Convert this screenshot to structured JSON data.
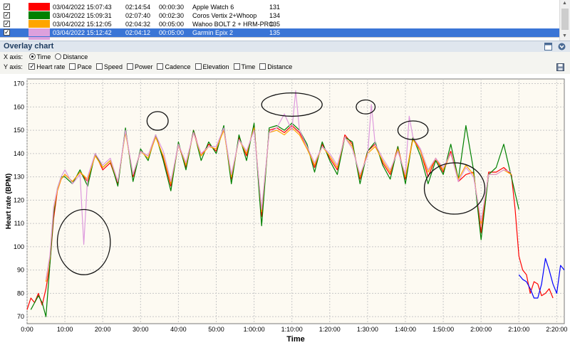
{
  "table": {
    "rows": [
      {
        "checked": true,
        "color": "#ff0000",
        "date": "03/04/2022 15:07:43",
        "duration": "02:14:54",
        "offset": "00:00:30",
        "name": "Apple Watch 6",
        "value": "131",
        "selected": false
      },
      {
        "checked": true,
        "color": "#008000",
        "date": "03/04/2022 15:09:31",
        "duration": "02:07:40",
        "offset": "00:02:30",
        "name": "Coros Vertix 2+Whoop",
        "value": "134",
        "selected": false
      },
      {
        "checked": true,
        "color": "#ffa500",
        "date": "03/04/2022 15:12:05",
        "duration": "02:04:32",
        "offset": "00:05:00",
        "name": "Wahoo BOLT 2 + HRM-PRO",
        "value": "135",
        "selected": false
      },
      {
        "checked": true,
        "color": "#dda0dd",
        "date": "03/04/2022 15:12:42",
        "duration": "02:04:12",
        "offset": "00:05:00",
        "name": "Garmin Epix 2",
        "value": "135",
        "selected": true
      }
    ]
  },
  "panel": {
    "title": "Overlay chart"
  },
  "controls": {
    "xaxis_label": "X axis:",
    "xaxis_options": [
      {
        "label": "Time",
        "selected": true
      },
      {
        "label": "Distance",
        "selected": false
      }
    ],
    "yaxis_label": "Y axis:",
    "yaxis_options": [
      {
        "label": "Heart rate",
        "checked": true
      },
      {
        "label": "Pace",
        "checked": false
      },
      {
        "label": "Speed",
        "checked": false
      },
      {
        "label": "Power",
        "checked": false
      },
      {
        "label": "Cadence",
        "checked": false
      },
      {
        "label": "Elevation",
        "checked": false
      },
      {
        "label": "Time",
        "checked": false
      },
      {
        "label": "Distance",
        "checked": false
      }
    ]
  },
  "chart_data": {
    "type": "line",
    "xlabel": "Time",
    "ylabel": "Heart rate (BPM)",
    "xlim": [
      0,
      142
    ],
    "ylim": [
      67,
      172
    ],
    "yticks": [
      70,
      80,
      90,
      100,
      110,
      120,
      130,
      140,
      150,
      160,
      170
    ],
    "xticks": [
      {
        "v": 0,
        "label": "0:00"
      },
      {
        "v": 10,
        "label": "10:00"
      },
      {
        "v": 20,
        "label": "20:00"
      },
      {
        "v": 30,
        "label": "30:00"
      },
      {
        "v": 40,
        "label": "40:00"
      },
      {
        "v": 50,
        "label": "50:00"
      },
      {
        "v": 60,
        "label": "1:00:00"
      },
      {
        "v": 70,
        "label": "1:10:00"
      },
      {
        "v": 80,
        "label": "1:20:00"
      },
      {
        "v": 90,
        "label": "1:30:00"
      },
      {
        "v": 100,
        "label": "1:40:00"
      },
      {
        "v": 110,
        "label": "1:50:00"
      },
      {
        "v": 120,
        "label": "2:00:00"
      },
      {
        "v": 130,
        "label": "2:10:00"
      },
      {
        "v": 140,
        "label": "2:20:00"
      }
    ],
    "grid": true,
    "background": "#fdfaf2",
    "series": [
      {
        "color": "#ff0000",
        "x": [
          0,
          1,
          2,
          3,
          4,
          5,
          6,
          7,
          8,
          9,
          10,
          12,
          14,
          16,
          18,
          20,
          22,
          24,
          26,
          28,
          30,
          32,
          34,
          36,
          38,
          40,
          42,
          44,
          46,
          48,
          50,
          52,
          54,
          56,
          58,
          60,
          62,
          64,
          66,
          68,
          70,
          72,
          74,
          76,
          78,
          80,
          82,
          84,
          86,
          88,
          90,
          92,
          94,
          96,
          98,
          100,
          102,
          104,
          106,
          108,
          110,
          112,
          114,
          116,
          118,
          120,
          122,
          124,
          126,
          128,
          129,
          130,
          131,
          132,
          133,
          134,
          135,
          136,
          137,
          138,
          139
        ],
        "y": [
          73,
          78,
          76,
          80,
          75,
          82,
          92,
          112,
          124,
          129,
          131,
          128,
          132,
          128,
          140,
          133,
          136,
          127,
          150,
          130,
          141,
          139,
          148,
          138,
          126,
          144,
          134,
          150,
          139,
          144,
          141,
          151,
          129,
          147,
          139,
          152,
          113,
          150,
          151,
          149,
          152,
          149,
          143,
          134,
          144,
          138,
          133,
          148,
          144,
          129,
          141,
          144,
          136,
          131,
          143,
          129,
          147,
          141,
          130,
          138,
          132,
          141,
          128,
          131,
          132,
          106,
          132,
          132,
          134,
          131,
          116,
          96,
          90,
          88,
          80,
          85,
          84,
          79,
          80,
          82,
          78
        ]
      },
      {
        "color": "#008000",
        "x": [
          1,
          2,
          3,
          4,
          5,
          6,
          7,
          8,
          9,
          10,
          12,
          14,
          16,
          18,
          20,
          22,
          24,
          26,
          28,
          30,
          32,
          34,
          36,
          38,
          40,
          42,
          44,
          46,
          48,
          50,
          52,
          54,
          56,
          58,
          60,
          62,
          64,
          66,
          68,
          70,
          72,
          74,
          76,
          78,
          80,
          82,
          84,
          86,
          88,
          90,
          92,
          94,
          96,
          98,
          100,
          102,
          104,
          106,
          108,
          110,
          112,
          114,
          116,
          118,
          120,
          122,
          124,
          126,
          128,
          130
        ],
        "y": [
          73,
          76,
          79,
          76,
          70,
          92,
          114,
          125,
          130,
          130,
          127,
          133,
          126,
          140,
          134,
          137,
          126,
          151,
          128,
          142,
          137,
          148,
          137,
          124,
          145,
          133,
          150,
          137,
          145,
          140,
          152,
          127,
          148,
          137,
          153,
          109,
          151,
          152,
          150,
          153,
          150,
          144,
          132,
          145,
          137,
          131,
          147,
          145,
          127,
          141,
          145,
          135,
          129,
          143,
          127,
          147,
          139,
          127,
          137,
          131,
          144,
          129,
          152,
          133,
          103,
          131,
          134,
          144,
          130,
          116
        ]
      },
      {
        "color": "#ffa500",
        "x": [
          5,
          6,
          7,
          8,
          9,
          10,
          12,
          14,
          16,
          18,
          20,
          22,
          24,
          26,
          28,
          30,
          32,
          34,
          36,
          38,
          40,
          42,
          44,
          46,
          48,
          50,
          52,
          54,
          56,
          58,
          60,
          62,
          64,
          66,
          68,
          70,
          72,
          74,
          76,
          78,
          80,
          82,
          84,
          86,
          88,
          90,
          92,
          94,
          96,
          98,
          100,
          102,
          104,
          106,
          108,
          110,
          112,
          114,
          116,
          118,
          120,
          122,
          124,
          126,
          128
        ],
        "y": [
          85,
          95,
          116,
          124,
          129,
          131,
          128,
          132,
          129,
          139,
          134,
          137,
          128,
          149,
          131,
          141,
          138,
          147,
          139,
          127,
          144,
          135,
          149,
          139,
          143,
          142,
          150,
          130,
          146,
          140,
          151,
          115,
          149,
          150,
          148,
          151,
          148,
          142,
          135,
          143,
          139,
          134,
          147,
          143,
          130,
          140,
          143,
          137,
          132,
          142,
          130,
          146,
          141,
          132,
          138,
          133,
          140,
          129,
          135,
          131,
          110,
          131,
          131,
          133,
          131
        ]
      },
      {
        "color": "#dd99dd",
        "x": [
          5,
          6,
          7,
          8,
          9,
          10,
          12,
          14,
          15,
          16,
          18,
          20,
          22,
          24,
          26,
          28,
          30,
          32,
          34,
          36,
          38,
          40,
          42,
          44,
          46,
          48,
          50,
          52,
          54,
          56,
          58,
          60,
          62,
          64,
          66,
          68,
          70,
          71,
          72,
          74,
          76,
          78,
          80,
          82,
          84,
          86,
          88,
          90,
          91,
          92,
          94,
          96,
          98,
          100,
          101,
          102,
          104,
          106,
          108,
          110,
          112,
          114,
          116,
          118,
          120,
          122,
          124,
          126,
          128
        ],
        "y": [
          86,
          96,
          117,
          125,
          130,
          133,
          127,
          131,
          101,
          130,
          140,
          135,
          138,
          128,
          150,
          131,
          141,
          139,
          148,
          141,
          128,
          144,
          136,
          149,
          140,
          143,
          143,
          151,
          131,
          146,
          141,
          150,
          116,
          149,
          151,
          157,
          150,
          167,
          150,
          143,
          136,
          143,
          140,
          135,
          147,
          142,
          131,
          139,
          161,
          144,
          138,
          133,
          141,
          131,
          156,
          147,
          142,
          133,
          138,
          134,
          140,
          128,
          134,
          130,
          111,
          131,
          131,
          133,
          132
        ]
      },
      {
        "color": "#0000ff",
        "x": [
          130,
          131,
          132,
          133,
          134,
          135,
          136,
          137,
          138,
          139,
          140,
          141,
          142
        ],
        "y": [
          88,
          86,
          85,
          82,
          78,
          78,
          84,
          95,
          90,
          84,
          80,
          92,
          90
        ]
      }
    ],
    "annotations": [
      {
        "cx": 15,
        "cy": 102,
        "rx": 7,
        "ry": 14
      },
      {
        "cx": 34.5,
        "cy": 154,
        "rx": 2.8,
        "ry": 4
      },
      {
        "cx": 70,
        "cy": 161,
        "rx": 8,
        "ry": 5
      },
      {
        "cx": 89.5,
        "cy": 160,
        "rx": 2.5,
        "ry": 3
      },
      {
        "cx": 102,
        "cy": 150,
        "rx": 4,
        "ry": 4
      },
      {
        "cx": 113,
        "cy": 125,
        "rx": 8,
        "ry": 11
      }
    ]
  }
}
